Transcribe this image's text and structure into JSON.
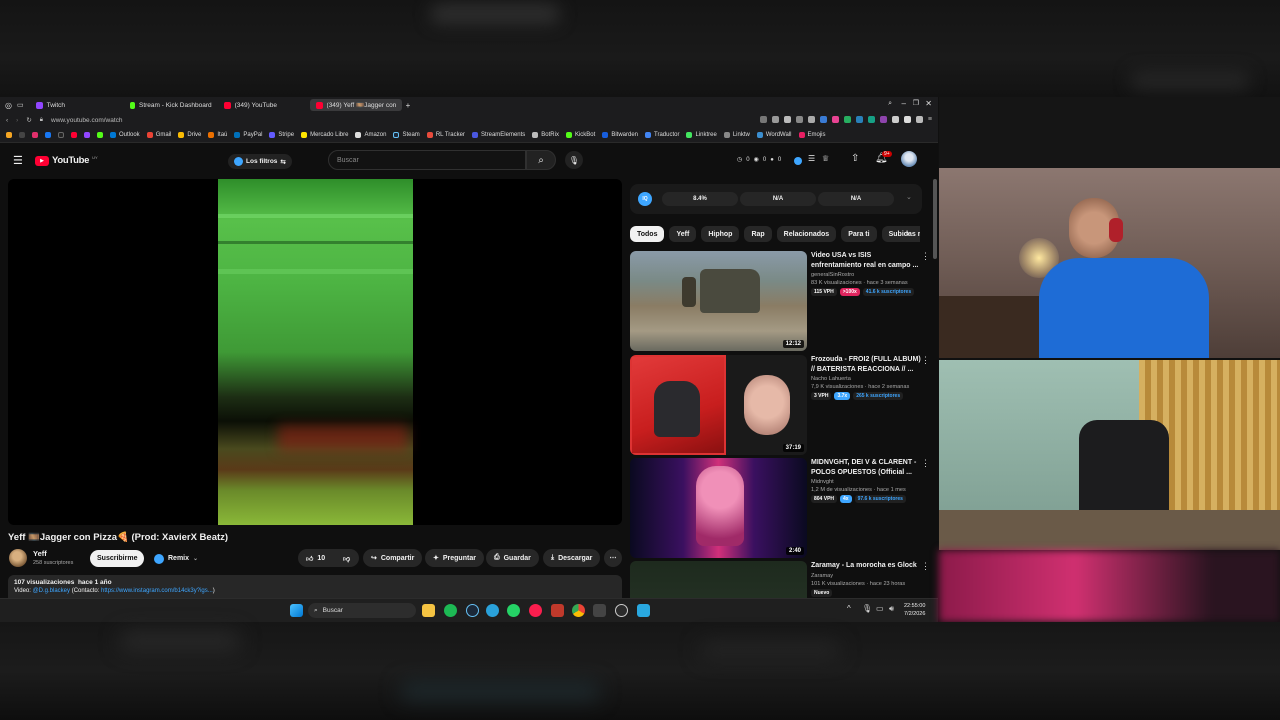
{
  "browser": {
    "tabs": [
      {
        "label": "Twitch",
        "color": "#9146ff"
      },
      {
        "label": "Stream - Kick Dashboard",
        "color": "#53fc18"
      },
      {
        "label": "(349) YouTube",
        "color": "#ff0033"
      },
      {
        "label": "(349) Yeff 🎞️Jagger con",
        "color": "#ff0033"
      }
    ],
    "url": "www.youtube.com/watch",
    "bookmarks": [
      "Outlook",
      "Gmail",
      "Drive",
      "Itaú",
      "PayPal",
      "Stripe",
      "Mercado Libre",
      "Amazon",
      "Steam",
      "RL Tracker",
      "StreamElements",
      "BotRix",
      "KickBot",
      "Bitwarden",
      "Traductor",
      "Linktree",
      "Linktw",
      "WordWall",
      "Emojis"
    ]
  },
  "youtube": {
    "logo": "YouTube",
    "country": "UY",
    "filters": "Los filtros",
    "search_placeholder": "Buscar",
    "header_stats": [
      "0",
      "0",
      "0"
    ],
    "notif_badge": "9+",
    "iq_stats": [
      "8.4%",
      "N/A",
      "N/A"
    ],
    "chips": [
      "Todos",
      "Yeff",
      "Hiphop",
      "Rap",
      "Relacionados",
      "Para ti",
      "Subidas reci"
    ],
    "video": {
      "title": "Yeff 🎞️Jagger con Pizza🍕 (Prod: XavierX Beatz)",
      "channel": "Yeff",
      "subs": "258 suscriptores",
      "subscribe": "Suscribirme",
      "remix": "Remix",
      "likes": "10",
      "share": "Compartir",
      "ask": "Preguntar",
      "save": "Guardar",
      "download": "Descargar",
      "views": "107 visualizaciones  hace 1 año",
      "desc_prefix": "Video: ",
      "desc_handle": "@D.g.blackey",
      "desc_mid": " (Contacto: ",
      "desc_link": "https://www.instagram.com/b14ck3y?igs...",
      "desc_end": ")"
    },
    "recommendations": [
      {
        "title": "Video USA vs ISIS enfrentamiento real en campo ...",
        "channel": "generalSinRostro",
        "meta": "83 K visualizaciones · hace 3 semanas",
        "stats": [
          "115 VPH",
          ">100x",
          "41.6 k suscriptores"
        ],
        "duration": "12:12"
      },
      {
        "title": "Frozouda - FROI2 (FULL ALBUM) // BATERISTA REACCIONA // ...",
        "channel": "Nacho Lahuerta",
        "meta": "7,9 K visualizaciones · hace 2 semanas",
        "stats": [
          "3 VPH",
          "3.7x",
          "265 k suscriptores"
        ],
        "duration": "37:19"
      },
      {
        "title": "MIDNVGHT, DEI V & CLARENT - POLOS OPUESTOS (Official ...",
        "channel": "Midnvght",
        "meta": "1,2 M de visualizaciones · hace 1 mes",
        "stats": [
          "804 VPH",
          "4x",
          "97.6 k suscriptores"
        ],
        "duration": "2:40"
      },
      {
        "title": "Zaramay - La morocha es Glock",
        "channel": "Zaramay",
        "meta": "101 K visualizaciones · hace 23 horas",
        "stats": [
          "Nuevo"
        ],
        "duration": ""
      }
    ]
  },
  "taskbar": {
    "search": "Buscar",
    "time": "22:55:00",
    "date": "7/2/2026"
  }
}
